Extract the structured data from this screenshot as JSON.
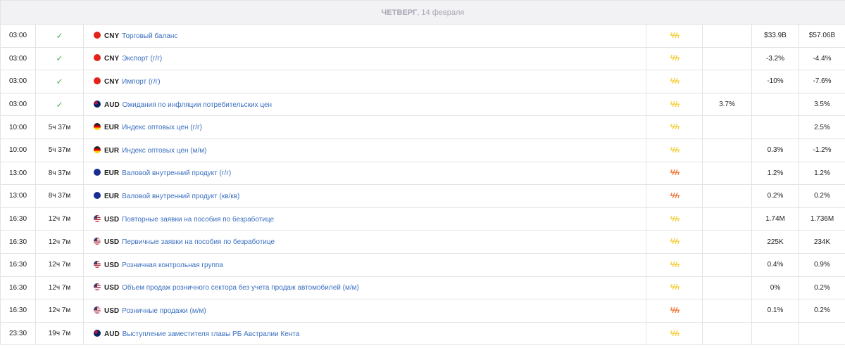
{
  "header": {
    "weekday": "ЧЕТВЕРГ",
    "date": ", 14 февраля"
  },
  "colors": {
    "impact_medium": "#f5cd32",
    "impact_high": "#f26e2c",
    "event_link": "#3b6fc0",
    "check": "#4caf50"
  },
  "rows": [
    {
      "time": "03:00",
      "status": "✓",
      "flag": "cny-flag-icon",
      "currency": "CNY",
      "event": "Торговый баланс",
      "impact_icon": "lightning-medium-icon",
      "impact": "ϟϟϟ",
      "actual": "",
      "forecast": "$33.9B",
      "previous": "$57.06B"
    },
    {
      "time": "03:00",
      "status": "✓",
      "flag": "cny-flag-icon",
      "currency": "CNY",
      "event": "Экспорт (г/г)",
      "impact_icon": "lightning-medium-icon",
      "impact": "ϟϟϟ",
      "actual": "",
      "forecast": "-3.2%",
      "previous": "-4.4%"
    },
    {
      "time": "03:00",
      "status": "✓",
      "flag": "cny-flag-icon",
      "currency": "CNY",
      "event": "Импорт (г/г)",
      "impact_icon": "lightning-medium-icon",
      "impact": "ϟϟϟ",
      "actual": "",
      "forecast": "-10%",
      "previous": "-7.6%"
    },
    {
      "time": "03:00",
      "status": "✓",
      "flag": "aud-flag-icon",
      "currency": "AUD",
      "event": "Ожидания по инфляции потребительских цен",
      "impact_icon": "lightning-medium-icon",
      "impact": "ϟϟϟ",
      "actual": "3.7%",
      "forecast": "",
      "previous": "3.5%"
    },
    {
      "time": "10:00",
      "status": "5ч 37м",
      "flag": "eur-flag-icon",
      "currency": "EUR",
      "event": "Индекс оптовых цен (г/г)",
      "impact_icon": "lightning-medium-icon",
      "impact": "ϟϟϟ",
      "actual": "",
      "forecast": "",
      "previous": "2.5%"
    },
    {
      "time": "10:00",
      "status": "5ч 37м",
      "flag": "eur-flag-icon",
      "currency": "EUR",
      "event": "Индекс оптовых цен (м/м)",
      "impact_icon": "lightning-medium-icon",
      "impact": "ϟϟϟ",
      "actual": "",
      "forecast": "0.3%",
      "previous": "-1.2%"
    },
    {
      "time": "13:00",
      "status": "8ч 37м",
      "flag": "eu-flag-icon",
      "currency": "EUR",
      "event": "Валовой внутренний продукт (г/г)",
      "impact_icon": "lightning-high-icon",
      "impact": "ϟϟϟ",
      "actual": "",
      "forecast": "1.2%",
      "previous": "1.2%"
    },
    {
      "time": "13:00",
      "status": "8ч 37м",
      "flag": "eu-flag-icon",
      "currency": "EUR",
      "event": "Валовой внутренний продукт (кв/кв)",
      "impact_icon": "lightning-high-icon",
      "impact": "ϟϟϟ",
      "actual": "",
      "forecast": "0.2%",
      "previous": "0.2%"
    },
    {
      "time": "16:30",
      "status": "12ч 7м",
      "flag": "usd-flag-icon",
      "currency": "USD",
      "event": "Повторные заявки на пособия по безработице",
      "impact_icon": "lightning-medium-icon",
      "impact": "ϟϟϟ",
      "actual": "",
      "forecast": "1.74M",
      "previous": "1.736M"
    },
    {
      "time": "16:30",
      "status": "12ч 7м",
      "flag": "usd-flag-icon",
      "currency": "USD",
      "event": "Первичные заявки на пособия по безработице",
      "impact_icon": "lightning-medium-icon",
      "impact": "ϟϟϟ",
      "actual": "",
      "forecast": "225K",
      "previous": "234K"
    },
    {
      "time": "16:30",
      "status": "12ч 7м",
      "flag": "usd-flag-icon",
      "currency": "USD",
      "event": "Розничная контрольная группа",
      "impact_icon": "lightning-medium-icon",
      "impact": "ϟϟϟ",
      "actual": "",
      "forecast": "0.4%",
      "previous": "0.9%"
    },
    {
      "time": "16:30",
      "status": "12ч 7м",
      "flag": "usd-flag-icon",
      "currency": "USD",
      "event": "Объем продаж розничного сектора без учета продаж автомобилей (м/м)",
      "impact_icon": "lightning-medium-icon",
      "impact": "ϟϟϟ",
      "actual": "",
      "forecast": "0%",
      "previous": "0.2%"
    },
    {
      "time": "16:30",
      "status": "12ч 7м",
      "flag": "usd-flag-icon",
      "currency": "USD",
      "event": "Розничные продажи (м/м)",
      "impact_icon": "lightning-high-icon",
      "impact": "ϟϟϟ",
      "actual": "",
      "forecast": "0.1%",
      "previous": "0.2%"
    },
    {
      "time": "23:30",
      "status": "19ч 7м",
      "flag": "aud-flag-icon",
      "currency": "AUD",
      "event": "Выступление заместителя главы РБ Австралии Кента",
      "impact_icon": "lightning-medium-icon",
      "impact": "ϟϟϟ",
      "actual": "",
      "forecast": "",
      "previous": ""
    }
  ]
}
